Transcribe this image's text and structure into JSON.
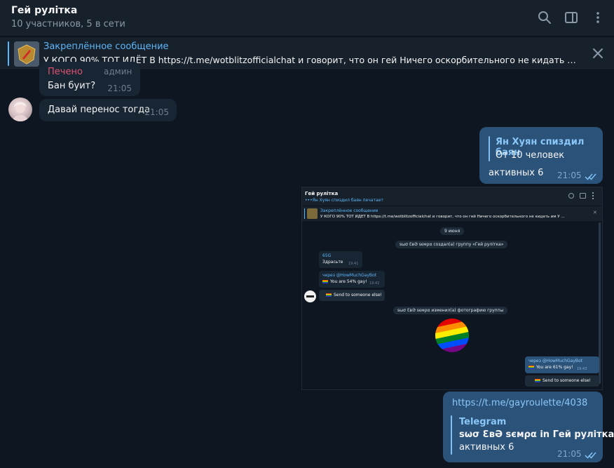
{
  "header": {
    "title": "Гей рулітка",
    "subtitle": "10 участников, 5 в сети",
    "icons": [
      "search-icon",
      "sidebar-toggle-icon",
      "more-vertical-icon"
    ]
  },
  "pinned": {
    "label": "Закреплённое сообщение",
    "text": "У КОГО 90% ТОТ ИДЁТ В https://t.me/wotblitzofficialchat и говорит, что он гей Ничего оскорбительного не кидать им  У ..."
  },
  "messages": {
    "m1": {
      "sender": "Печено",
      "role": "админ",
      "text": "Бан буит?",
      "time": "21:05"
    },
    "m2": {
      "text": "Давай перенос тогда",
      "time": "21:05"
    },
    "m3": {
      "reply_name": "Ян Хуян спиздил баян",
      "reply_text": "От 10 человек",
      "text": "активных 6",
      "time": "21:05"
    },
    "m4": {
      "link": "https://t.me/gayroulette/4038",
      "preview_site": "Telegram",
      "preview_title": "ѕωσ ƐвƏ ѕємρα in Гей рулітка",
      "preview_desc": "активных 6",
      "time": "21:05"
    }
  },
  "screenshot": {
    "title": "Гей рулітка",
    "typing": "•••Ян Хуян спиздил баян печатает",
    "pin_label": "Закреплённое сообщение",
    "pin_text": "У КОГО 90% ТОТ ИДЁТ В https://t.me/wotblitzofficialchat и говорит, что он гей Ничего оскорбительного не кидать им  У ...",
    "date": "9 июня",
    "service1": "ѕωσ ƐвƏ ѕємρα создал(а) группу «Гей рулітка»",
    "in1_name": "65G",
    "in1_text": "Здрасьте",
    "in1_time": "19:41",
    "bot_via": "через @HowMuchGayBot",
    "bot_text": "You are 54% gay!",
    "bot_time": "19:42",
    "send_btn": "Send to someone else!",
    "service2": "ѕωσ ƐвƏ ѕємρα изменил(а) фотографию группы",
    "out_via": "через @HowMuchGayBot",
    "out_text": "You are 61% gay!",
    "out_time": "19:43",
    "out_btn": "Send to someone else!"
  }
}
